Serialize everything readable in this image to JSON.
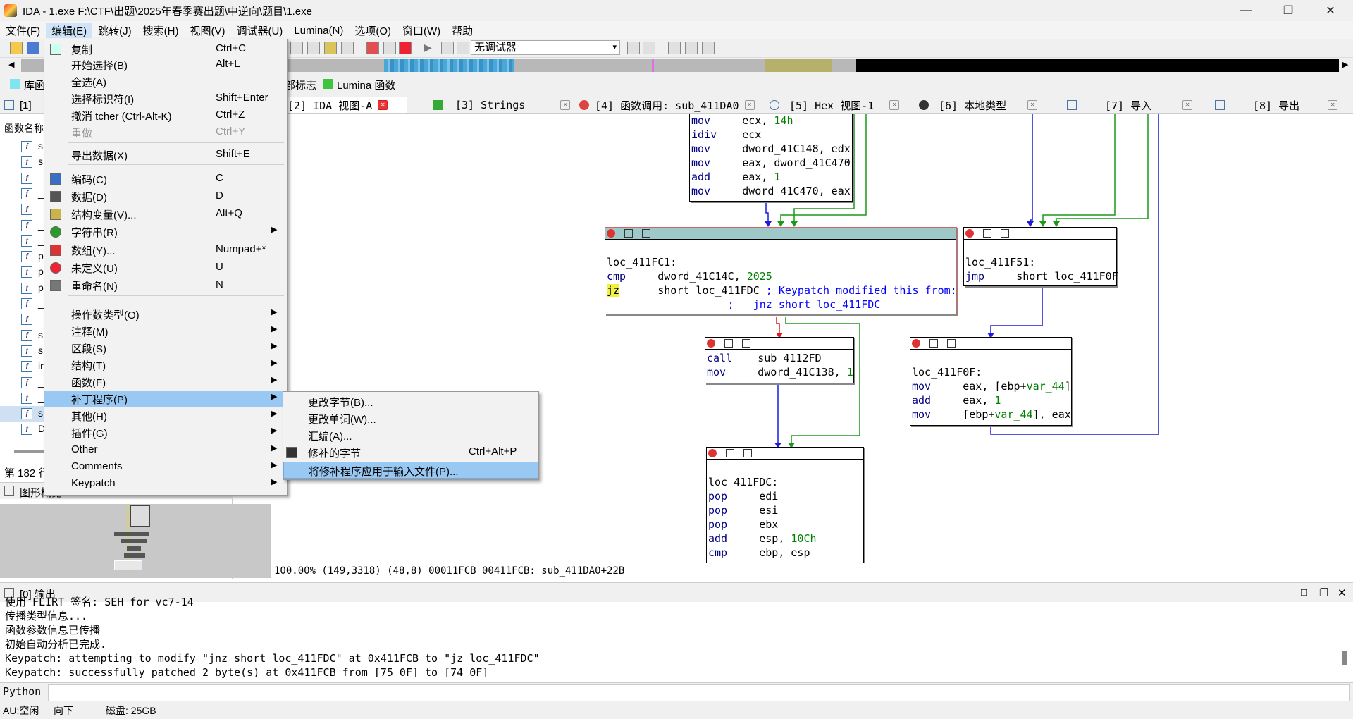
{
  "window": {
    "title": "IDA - 1.exe F:\\CTF\\出题\\2025年春季赛出题\\中逆向\\题目\\1.exe",
    "minimize": "—",
    "maximize": "❐",
    "close": "✕"
  },
  "menubar": [
    "文件(F)",
    "编辑(E)",
    "跳转(J)",
    "搜索(H)",
    "视图(V)",
    "调试器(U)",
    "Lumina(N)",
    "选项(O)",
    "窗口(W)",
    "帮助"
  ],
  "toolbar": {
    "debugger": "无调试器"
  },
  "legend": {
    "lib_label": "库函",
    "flag_label": "部标志",
    "lumina_label": "Lumina 函数"
  },
  "tabs": [
    {
      "label": "[1]"
    },
    {
      "label": "[2]  IDA 视图-A"
    },
    {
      "label": "[3]  Strings"
    },
    {
      "label": "[4]  函数调用: sub_411DA0"
    },
    {
      "label": "[5]  Hex 视图-1"
    },
    {
      "label": "[6]  本地类型"
    },
    {
      "label": "[7]  导入"
    },
    {
      "label": "[8]  导出"
    }
  ],
  "left_panel": {
    "header": "函数名称",
    "rows": [
      "s",
      "s",
      "_",
      "_",
      "_",
      "_",
      "_",
      "p",
      "p",
      "p",
      "_",
      "_",
      "s",
      "s",
      "ir",
      "_",
      "_",
      "s",
      "D"
    ],
    "count": "第 182 行",
    "overview_title": "图形概览"
  },
  "context_menu": {
    "items": [
      {
        "label": "复制",
        "shortcut": "Ctrl+C"
      },
      {
        "label": "开始选择(B)",
        "shortcut": "Alt+L"
      },
      {
        "label": "全选(A)",
        "shortcut": ""
      },
      {
        "label": "选择标识符(I)",
        "shortcut": "Shift+Enter"
      },
      {
        "label": "撤消 tcher   (Ctrl-Alt-K)",
        "shortcut": "Ctrl+Z"
      },
      {
        "label": "重做",
        "shortcut": "Ctrl+Y"
      },
      {
        "label": "导出数据(X)",
        "shortcut": "Shift+E"
      },
      {
        "label": "编码(C)",
        "shortcut": "C"
      },
      {
        "label": "数据(D)",
        "shortcut": "D"
      },
      {
        "label": "结构变量(V)...",
        "shortcut": "Alt+Q"
      },
      {
        "label": "字符串(R)",
        "shortcut": ""
      },
      {
        "label": "数组(Y)...",
        "shortcut": "Numpad+*"
      },
      {
        "label": "未定义(U)",
        "shortcut": "U"
      },
      {
        "label": "重命名(N)",
        "shortcut": "N"
      },
      {
        "label": "操作数类型(O)",
        "shortcut": ""
      },
      {
        "label": "注释(M)",
        "shortcut": ""
      },
      {
        "label": "区段(S)",
        "shortcut": ""
      },
      {
        "label": "结构(T)",
        "shortcut": ""
      },
      {
        "label": "函数(F)",
        "shortcut": ""
      },
      {
        "label": "补丁程序(P)",
        "shortcut": ""
      },
      {
        "label": "其他(H)",
        "shortcut": ""
      },
      {
        "label": "插件(G)",
        "shortcut": ""
      },
      {
        "label": "Other",
        "shortcut": ""
      },
      {
        "label": "Comments",
        "shortcut": ""
      },
      {
        "label": "Keypatch",
        "shortcut": ""
      }
    ]
  },
  "submenu": {
    "items": [
      {
        "label": "更改字节(B)...",
        "shortcut": ""
      },
      {
        "label": "更改单词(W)...",
        "shortcut": ""
      },
      {
        "label": "汇编(A)...",
        "shortcut": ""
      },
      {
        "label": "修补的字节",
        "shortcut": "Ctrl+Alt+P"
      },
      {
        "label": "将修补程序应用于输入文件(P)...",
        "shortcut": ""
      }
    ]
  },
  "graph": {
    "status": "100.00% (149,3318) (48,8) 00011FCB 00411FCB: sub_411DA0+22B"
  },
  "output": {
    "title": "[0]  输出",
    "lines": [
      "使用 FLIRT 签名: SEH for vc7-14",
      "传播类型信息...",
      "函数参数信息已传播",
      "初始自动分析已完成.",
      "Keypatch: attempting to modify \"jnz short loc_411FDC\" at 0x411FCB to \"jz loc_411FDC\"",
      "Keypatch: successfully patched 2 byte(s) at 0x411FCB from [75 0F] to [74 0F]"
    ]
  },
  "python_label": "Python",
  "statusbar": {
    "au": "AU:空闲",
    "dir": "向下",
    "disk": "磁盘: 25GB"
  }
}
